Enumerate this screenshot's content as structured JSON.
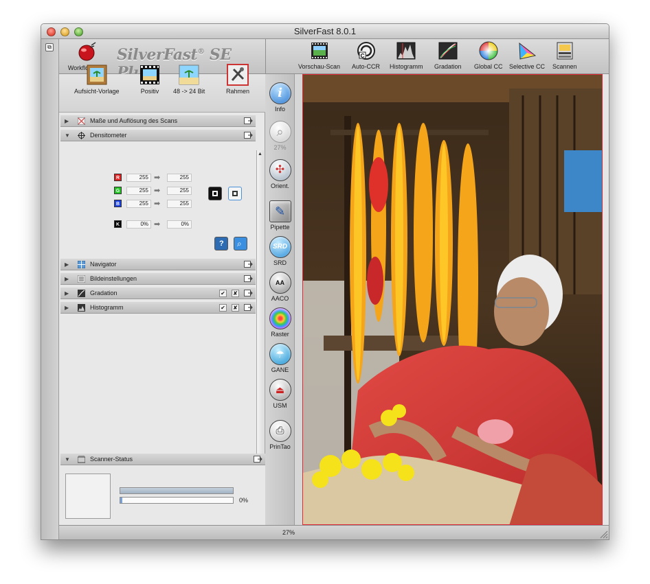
{
  "window": {
    "title": "SilverFast 8.0.1"
  },
  "header": {
    "workflow_pilot": "WorkflowPilot",
    "brand_name": "SilverFast",
    "brand_reg": "®",
    "brand_edition": "SE Plus",
    "tools": [
      {
        "label": "Vorschau-Scan",
        "icon": "preview-scan-icon"
      },
      {
        "label": "Auto-CCR",
        "icon": "auto-ccr-icon"
      },
      {
        "label": "Histogramm",
        "icon": "histogram-icon"
      },
      {
        "label": "Gradation",
        "icon": "gradation-icon"
      },
      {
        "label": "Global CC",
        "icon": "global-cc-icon"
      },
      {
        "label": "Selective CC",
        "icon": "selective-cc-icon"
      },
      {
        "label": "Scannen",
        "icon": "scan-icon"
      }
    ]
  },
  "subtoolbar": [
    {
      "label": "Aufsicht-Vorlage",
      "icon": "reflective-original-icon"
    },
    {
      "label": "Positiv",
      "icon": "positive-film-icon"
    },
    {
      "label": "48 -> 24 Bit",
      "icon": "bit-depth-icon"
    },
    {
      "label": "Rahmen",
      "icon": "frame-tools-icon"
    }
  ],
  "panels": {
    "masse": "Maße und Auflösung des Scans",
    "densitometer": "Densitometer",
    "navigator": "Navigator",
    "bildeinstellungen": "Bildeinstellungen",
    "gradation": "Gradation",
    "histogramm": "Histogramm",
    "scanner_status": "Scanner-Status"
  },
  "densitometer": {
    "rows": [
      {
        "chip": "R",
        "color": "#e02020",
        "before": "255",
        "after": "255"
      },
      {
        "chip": "G",
        "color": "#22c422",
        "before": "255",
        "after": "255"
      },
      {
        "chip": "B",
        "color": "#1a3fe0",
        "before": "255",
        "after": "255"
      },
      {
        "chip": "K",
        "color": "#000000",
        "before": "0%",
        "after": "0%"
      }
    ]
  },
  "status": {
    "progress_label": "0%",
    "progress": 0
  },
  "vertical_tools": [
    {
      "label": "Info",
      "icon": "info-icon"
    },
    {
      "label": "27%",
      "icon": "zoom-icon"
    },
    {
      "label": "Orient.",
      "icon": "orientation-icon"
    },
    {
      "label": "Pipette",
      "icon": "pipette-icon"
    },
    {
      "label": "SRD",
      "icon": "srd-icon"
    },
    {
      "label": "AACO",
      "icon": "aaco-icon"
    },
    {
      "label": "Raster",
      "icon": "raster-icon"
    },
    {
      "label": "GANE",
      "icon": "gane-icon"
    },
    {
      "label": "USM",
      "icon": "usm-icon"
    },
    {
      "label": "PrinTao",
      "icon": "printao-icon"
    }
  ],
  "bottom": {
    "zoom": "27%"
  },
  "colors": {
    "accent_red": "#e02a3a",
    "panel_bg": "#e8e8e8"
  }
}
